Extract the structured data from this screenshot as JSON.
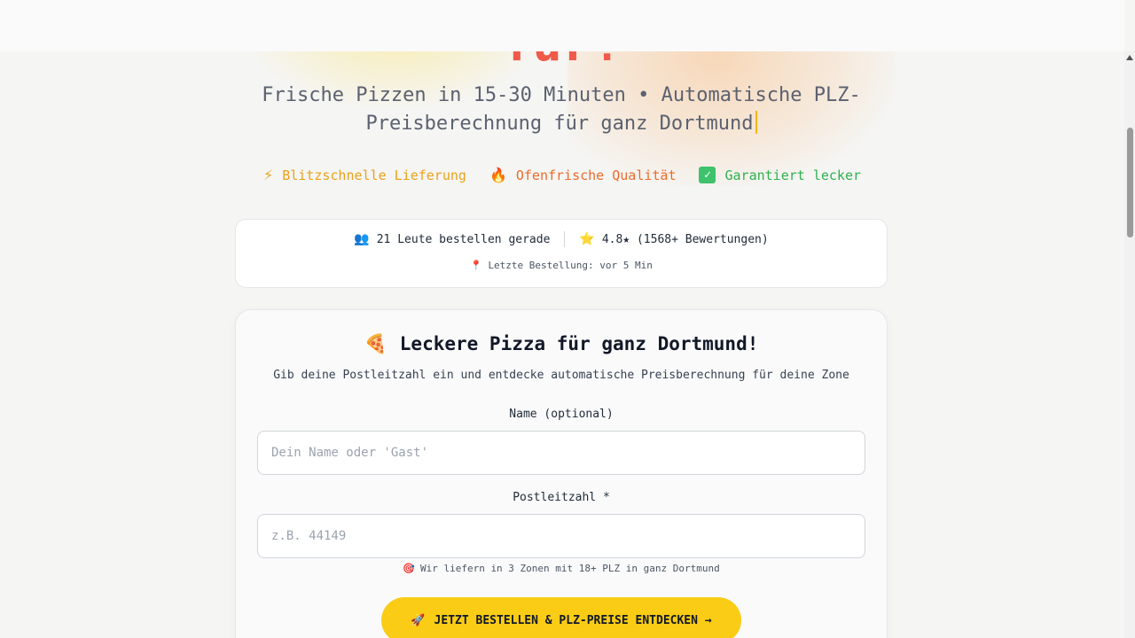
{
  "hero": {
    "title_fragment": "für!",
    "subtitle": "Frische Pizzen in 15-30 Minuten • Automatische PLZ-Preisberechnung für ganz Dortmund"
  },
  "features": [
    {
      "icon": "lightning-icon",
      "glyph": "⚡",
      "label": "Blitzschnelle Lieferung",
      "color": "#eaa21a"
    },
    {
      "icon": "fire-icon",
      "glyph": "🔥",
      "label": "Ofenfrische Qualität",
      "color": "#ec6b2c"
    },
    {
      "icon": "check-icon",
      "glyph": "✓",
      "label": "Garantiert lecker",
      "color": "#2fb14f"
    }
  ],
  "stats": {
    "people_icon": "👥",
    "people_text": "21 Leute bestellen gerade",
    "rating_icon": "⭐",
    "rating_text": "4.8★ (1568+ Bewertungen)",
    "pin_icon": "📍",
    "last_order_text": "Letzte Bestellung: vor 5 Min"
  },
  "order_card": {
    "title_icon": "🍕",
    "title": "Leckere Pizza für ganz Dortmund!",
    "description": "Gib deine Postleitzahl ein und entdecke automatische Preisberechnung für deine Zone",
    "name_label": "Name (optional)",
    "name_placeholder": "Dein Name oder 'Gast'",
    "name_value": "",
    "plz_label": "Postleitzahl *",
    "plz_placeholder": "z.B. 44149",
    "plz_value": "",
    "hint_icon": "🎯",
    "hint": "Wir liefern in 3 Zonen mit 18+ PLZ in ganz Dortmund",
    "cta_icon": "🚀",
    "cta_label": "JETZT BESTELLEN & PLZ-PREISE ENTDECKEN →"
  },
  "colors": {
    "accent_yellow": "#facc15",
    "hero_red": "#ef5a4a"
  }
}
